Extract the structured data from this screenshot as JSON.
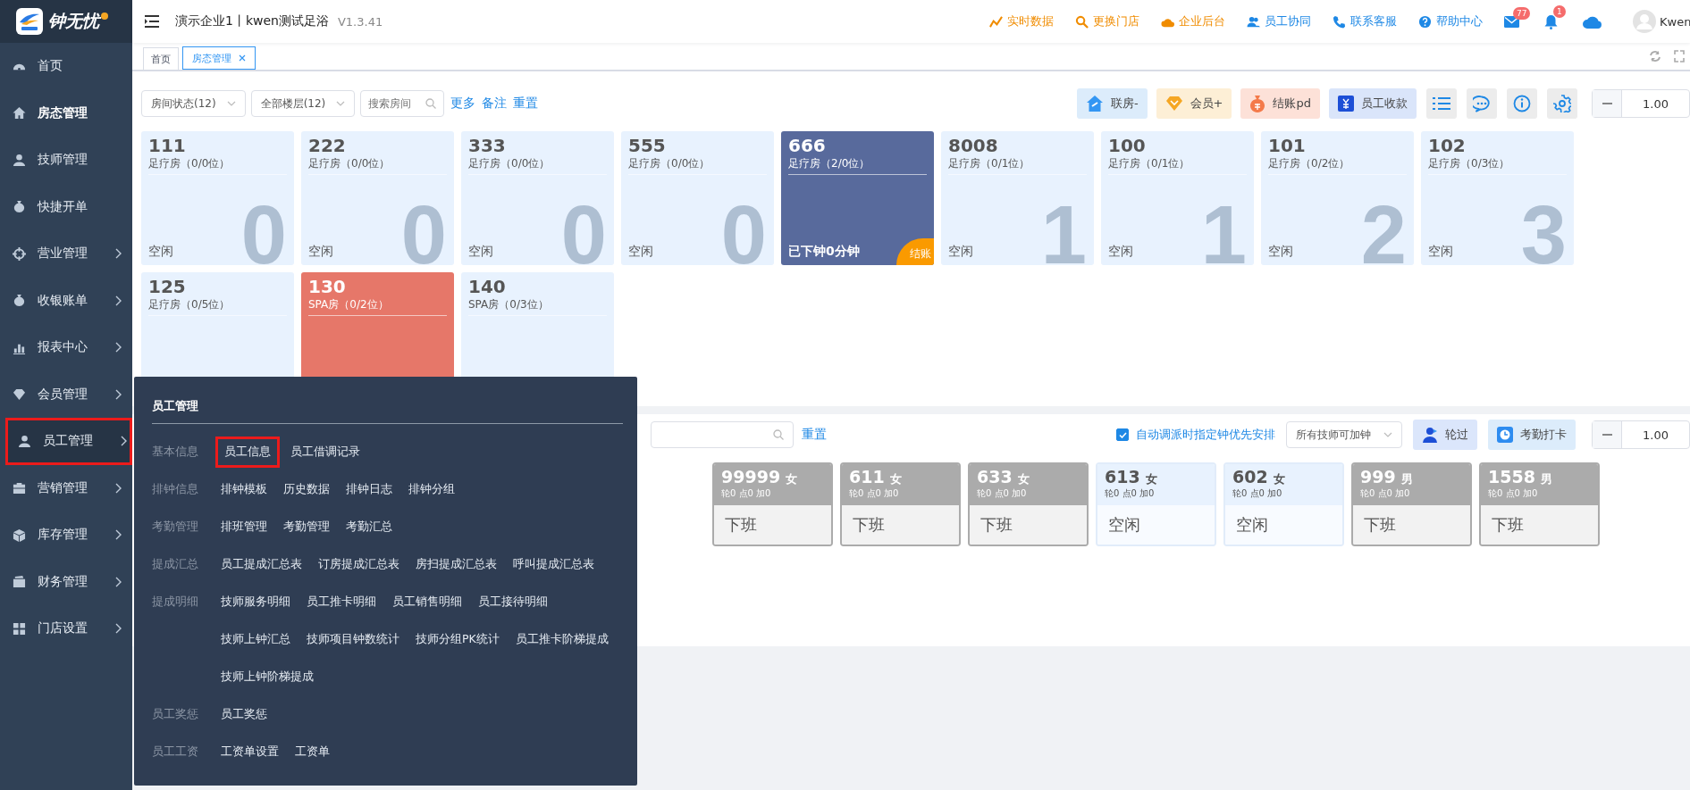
{
  "brand": {
    "name": "钟无忧"
  },
  "sidebar": {
    "items": [
      {
        "label": "首页",
        "selected": false,
        "submenu": false,
        "open": false,
        "highlighted": false
      },
      {
        "label": "房态管理",
        "selected": true,
        "submenu": false,
        "open": false,
        "highlighted": false
      },
      {
        "label": "技师管理",
        "selected": false,
        "submenu": false,
        "open": false,
        "highlighted": false
      },
      {
        "label": "快捷开单",
        "selected": false,
        "submenu": false,
        "open": false,
        "highlighted": false
      },
      {
        "label": "营业管理",
        "selected": false,
        "submenu": true,
        "open": false,
        "highlighted": false
      },
      {
        "label": "收银账单",
        "selected": false,
        "submenu": true,
        "open": false,
        "highlighted": false
      },
      {
        "label": "报表中心",
        "selected": false,
        "submenu": true,
        "open": false,
        "highlighted": false
      },
      {
        "label": "会员管理",
        "selected": false,
        "submenu": true,
        "open": false,
        "highlighted": false
      },
      {
        "label": "员工管理",
        "selected": false,
        "submenu": true,
        "open": true,
        "highlighted": true
      },
      {
        "label": "营销管理",
        "selected": false,
        "submenu": true,
        "open": false,
        "highlighted": false
      },
      {
        "label": "库存管理",
        "selected": false,
        "submenu": true,
        "open": false,
        "highlighted": false
      },
      {
        "label": "财务管理",
        "selected": false,
        "submenu": true,
        "open": false,
        "highlighted": false
      },
      {
        "label": "门店设置",
        "selected": false,
        "submenu": true,
        "open": false,
        "highlighted": false
      }
    ]
  },
  "header": {
    "company": "演示企业1丨kwen测试足浴",
    "version": "V1.3.41",
    "links": [
      {
        "label": "实时数据",
        "color": "#f08c00"
      },
      {
        "label": "更换门店",
        "color": "#f08c00"
      },
      {
        "label": "企业后台",
        "color": "#f08c00"
      },
      {
        "label": "员工协同",
        "color": "#1e88e5"
      },
      {
        "label": "联系客服",
        "color": "#1e88e5"
      },
      {
        "label": "帮助中心",
        "color": "#1e88e5"
      }
    ],
    "mail_badge": "77",
    "bell_badge": "1",
    "user": "Kwen"
  },
  "tabs": [
    {
      "label": "首页",
      "selected": false,
      "closable": false
    },
    {
      "label": "房态管理",
      "selected": true,
      "closable": true
    }
  ],
  "room_toolbar": {
    "filters": [
      {
        "value": "房间状态(12)"
      },
      {
        "value": "全部楼层(12)"
      }
    ],
    "search": {
      "placeholder": "搜索房间"
    },
    "links": [
      "更多",
      "备注",
      "重置"
    ],
    "actions": [
      {
        "label": "联房-",
        "kind": "link"
      },
      {
        "label": "会员+",
        "kind": "member"
      },
      {
        "label": "结账pd",
        "kind": "checkout"
      },
      {
        "label": "员工收款",
        "kind": "payment"
      }
    ],
    "zoom": {
      "value": "1.00"
    }
  },
  "rooms": [
    {
      "number": "111",
      "type": "足疗房（0/0位）",
      "status": "空闲",
      "capacity": "0",
      "kind": "idle"
    },
    {
      "number": "222",
      "type": "足疗房（0/0位）",
      "status": "空闲",
      "capacity": "0",
      "kind": "idle"
    },
    {
      "number": "333",
      "type": "足疗房（0/0位）",
      "status": "空闲",
      "capacity": "0",
      "kind": "idle"
    },
    {
      "number": "555",
      "type": "足疗房（0/0位）",
      "status": "空闲",
      "capacity": "0",
      "kind": "idle"
    },
    {
      "number": "666",
      "type": "足疗房（2/0位）",
      "status": "已下钟0分钟",
      "badge": "结账",
      "kind": "occupied"
    },
    {
      "number": "8008",
      "type": "足疗房（0/1位）",
      "status": "空闲",
      "capacity": "1",
      "kind": "idle"
    },
    {
      "number": "100",
      "type": "足疗房（0/1位）",
      "status": "空闲",
      "capacity": "1",
      "kind": "idle"
    },
    {
      "number": "101",
      "type": "足疗房（0/2位）",
      "status": "空闲",
      "capacity": "2",
      "kind": "idle"
    },
    {
      "number": "102",
      "type": "足疗房（0/3位）",
      "status": "空闲",
      "capacity": "3",
      "kind": "idle"
    },
    {
      "number": "125",
      "type": "足疗房（0/5位）",
      "kind": "idle"
    },
    {
      "number": "130",
      "type": "SPA房（0/2位）",
      "kind": "booked"
    },
    {
      "number": "140",
      "type": "SPA房（0/3位）",
      "kind": "idle"
    }
  ],
  "tech_toolbar": {
    "reset": "重置",
    "auto_assign": {
      "label": "自动调派时指定钟优先安排",
      "checked": true
    },
    "overtime": {
      "value": "所有技师可加钟"
    },
    "buttons": [
      {
        "label": "轮过",
        "kind": "skip"
      },
      {
        "label": "考勤打卡",
        "kind": "clock"
      }
    ],
    "zoom": {
      "value": "1.00"
    }
  },
  "technicians": [
    {
      "number": "99999",
      "gender": "女",
      "stats": "轮0 点0 加0",
      "status": "下班",
      "kind": "off"
    },
    {
      "number": "611",
      "gender": "女",
      "stats": "轮0 点0 加0",
      "status": "下班",
      "kind": "off"
    },
    {
      "number": "633",
      "gender": "女",
      "stats": "轮0 点0 加0",
      "status": "下班",
      "kind": "off"
    },
    {
      "number": "613",
      "gender": "女",
      "stats": "轮0 点0 加0",
      "status": "空闲",
      "kind": "idle"
    },
    {
      "number": "602",
      "gender": "女",
      "stats": "轮0 点0 加0",
      "status": "空闲",
      "kind": "idle"
    },
    {
      "number": "999",
      "gender": "男",
      "stats": "轮0 点0 加0",
      "status": "下班",
      "kind": "off"
    },
    {
      "number": "1558",
      "gender": "男",
      "stats": "轮0 点0 加0",
      "status": "下班",
      "kind": "off"
    }
  ],
  "flyout": {
    "title": "员工管理",
    "groups": [
      {
        "label": "基本信息",
        "lines": [
          [
            {
              "label": "员工信息",
              "highlighted": true
            },
            {
              "label": "员工借调记录",
              "highlighted": false
            }
          ]
        ]
      },
      {
        "label": "排钟信息",
        "lines": [
          [
            {
              "label": "排钟模板",
              "highlighted": false
            },
            {
              "label": "历史数据",
              "highlighted": false
            },
            {
              "label": "排钟日志",
              "highlighted": false
            },
            {
              "label": "排钟分组",
              "highlighted": false
            }
          ]
        ]
      },
      {
        "label": "考勤管理",
        "lines": [
          [
            {
              "label": "排班管理",
              "highlighted": false
            },
            {
              "label": "考勤管理",
              "highlighted": false
            },
            {
              "label": "考勤汇总",
              "highlighted": false
            }
          ]
        ]
      },
      {
        "label": "提成汇总",
        "lines": [
          [
            {
              "label": "员工提成汇总表",
              "highlighted": false
            },
            {
              "label": "订房提成汇总表",
              "highlighted": false
            },
            {
              "label": "房扫提成汇总表",
              "highlighted": false
            },
            {
              "label": "呼叫提成汇总表",
              "highlighted": false
            }
          ]
        ]
      },
      {
        "label": "提成明细",
        "lines": [
          [
            {
              "label": "技师服务明细",
              "highlighted": false
            },
            {
              "label": "员工推卡明细",
              "highlighted": false
            },
            {
              "label": "员工销售明细",
              "highlighted": false
            },
            {
              "label": "员工接待明细",
              "highlighted": false
            }
          ],
          [
            {
              "label": "技师上钟汇总",
              "highlighted": false
            },
            {
              "label": "技师项目钟数统计",
              "highlighted": false
            },
            {
              "label": "技师分组PK统计",
              "highlighted": false
            },
            {
              "label": "员工推卡阶梯提成",
              "highlighted": false
            }
          ],
          [
            {
              "label": "技师上钟阶梯提成",
              "highlighted": false
            }
          ]
        ]
      },
      {
        "label": "员工奖惩",
        "lines": [
          [
            {
              "label": "员工奖惩",
              "highlighted": false
            }
          ]
        ]
      },
      {
        "label": "员工工资",
        "lines": [
          [
            {
              "label": "工资单设置",
              "highlighted": false
            },
            {
              "label": "工资单",
              "highlighted": false
            }
          ]
        ]
      }
    ]
  }
}
